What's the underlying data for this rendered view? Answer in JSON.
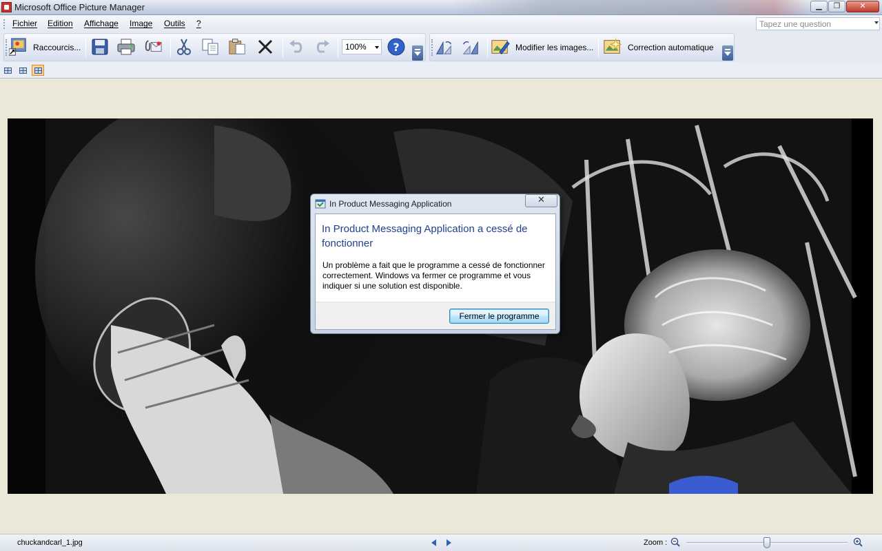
{
  "window": {
    "title": "Microsoft Office Picture Manager"
  },
  "menu": {
    "items": [
      "Fichier",
      "Edition",
      "Affichage",
      "Image",
      "Outils",
      "?"
    ],
    "question_placeholder": "Tapez une question"
  },
  "toolbar": {
    "shortcuts_label": "Raccourcis...",
    "zoom_value": "100%",
    "edit_pictures_label": "Modifier les images...",
    "auto_correct_label": "Correction automatique"
  },
  "dialog": {
    "title": "In Product Messaging Application",
    "main_instruction": "In Product Messaging Application a cessé de fonctionner",
    "content": "Un problème a fait que le programme a cessé de fonctionner correctement. Windows va fermer ce programme et vous indiquer si une solution est disponible.",
    "button": "Fermer le programme",
    "close_glyph": "✕"
  },
  "status": {
    "filename": "chuckandcarl_1.jpg",
    "zoom_label": "Zoom :"
  },
  "colors": {
    "accent": "#1f3f8f",
    "background": "#ebe8d7",
    "highlight": "#fcd49a"
  }
}
